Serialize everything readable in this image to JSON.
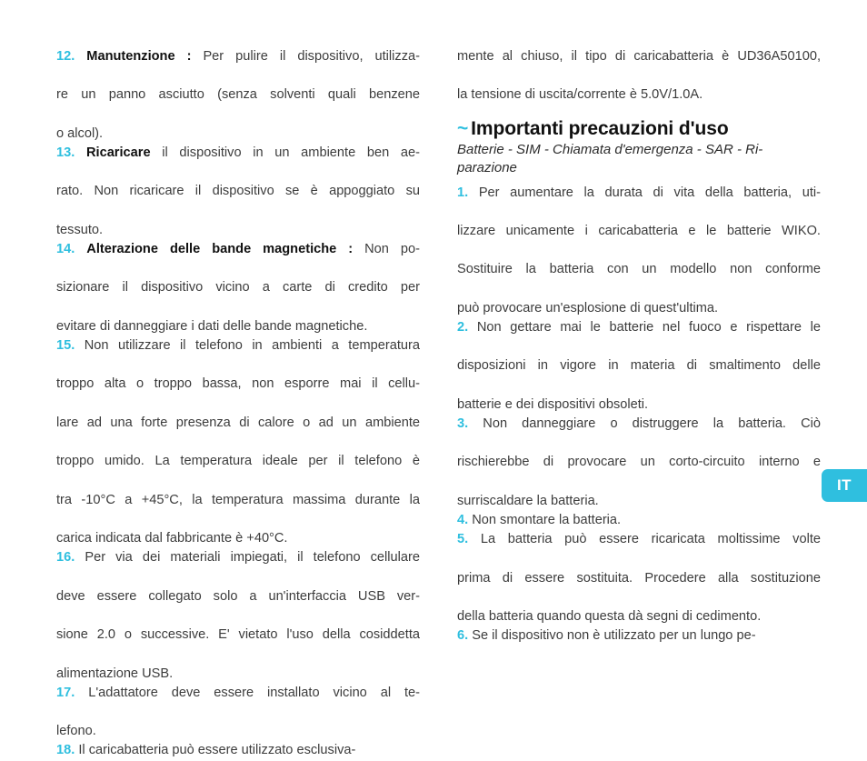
{
  "document": {
    "language_tab": "IT",
    "accent_color": "#2fbfdf",
    "body_color": "#3c3c3c",
    "heading_color": "#101010"
  },
  "left_column": {
    "items": [
      {
        "number": "12.",
        "lead": "Manutenzione :",
        "lines": [
          "Per pulire il dispositivo, utilizza-",
          "re un panno asciutto (senza solventi quali benzene",
          "o alcol)."
        ]
      },
      {
        "number": "13.",
        "lead": "Ricaricare",
        "lines": [
          "il dispositivo in un ambiente ben ae-",
          "rato. Non ricaricare il dispositivo se è appoggiato su",
          "tessuto."
        ]
      },
      {
        "number": "14.",
        "lead": "Alterazione delle bande magnetiche :",
        "lines": [
          "Non po-",
          "sizionare il dispositivo vicino a carte di credito per",
          "evitare di danneggiare i dati delle bande magnetiche."
        ]
      },
      {
        "number": "15.",
        "lead": "",
        "lines": [
          "Non utilizzare il telefono in ambienti a temperatura",
          "troppo alta o troppo bassa, non esporre mai il cellu-",
          "lare ad una forte presenza di calore o ad un ambiente",
          "troppo umido.  La temperatura ideale per il telefono è",
          "tra -10°C a +45°C, la temperatura massima durante la",
          "carica indicata dal fabbricante è  +40°C."
        ]
      },
      {
        "number": "16.",
        "lead": "",
        "lines": [
          "Per via dei materiali impiegati, il telefono cellulare",
          "deve essere collegato solo a un'interfaccia USB ver-",
          "sione 2.0 o successive. E' vietato l'uso della cosiddetta",
          "alimentazione USB."
        ]
      },
      {
        "number": "17.",
        "lead": "",
        "lines": [
          "L'adattatore deve essere installato vicino al te-",
          "lefono."
        ]
      },
      {
        "number": "18.",
        "lead": "",
        "lines": [
          "Il caricabatteria può essere utilizzato esclusiva-"
        ]
      }
    ]
  },
  "right_column": {
    "continuation": {
      "lines": [
        "mente al chiuso, il tipo di caricabatteria è UD36A50100,",
        "la tensione di uscita/corrente è 5.0V/1.0A."
      ]
    },
    "section": {
      "tilde": "~",
      "title": "Importanti precauzioni d'uso",
      "subtitle_lines": [
        "Batterie - SIM - Chiamata d'emergenza - SAR - Ri-",
        "parazione"
      ]
    },
    "items": [
      {
        "number": "1.",
        "lead": "",
        "lines": [
          "Per aumentare la durata di vita della batteria, uti-",
          "lizzare unicamente i caricabatteria e le batterie WIKO.",
          "Sostituire la batteria con un modello non conforme",
          "può provocare un'esplosione di quest'ultima."
        ]
      },
      {
        "number": "2.",
        "lead": "",
        "lines": [
          "Non gettare mai le batterie nel fuoco e rispettare le",
          "disposizioni in vigore in materia di smaltimento delle",
          "batterie e dei dispositivi obsoleti."
        ]
      },
      {
        "number": "3.",
        "lead": "",
        "lines": [
          "Non danneggiare o distruggere la batteria. Ciò",
          "rischierebbe di provocare un corto-circuito interno e",
          "surriscaldare la batteria."
        ]
      },
      {
        "number": "4.",
        "lead": "",
        "lines": [
          "Non smontare la batteria."
        ]
      },
      {
        "number": "5.",
        "lead": "",
        "lines": [
          "La batteria può essere ricaricata moltissime volte",
          "prima di essere sostituita. Procedere alla sostituzione",
          "della batteria quando questa dà segni di cedimento."
        ]
      },
      {
        "number": "6.",
        "lead": "",
        "lines": [
          "Se il dispositivo non è utilizzato per un lungo pe-"
        ]
      }
    ]
  }
}
